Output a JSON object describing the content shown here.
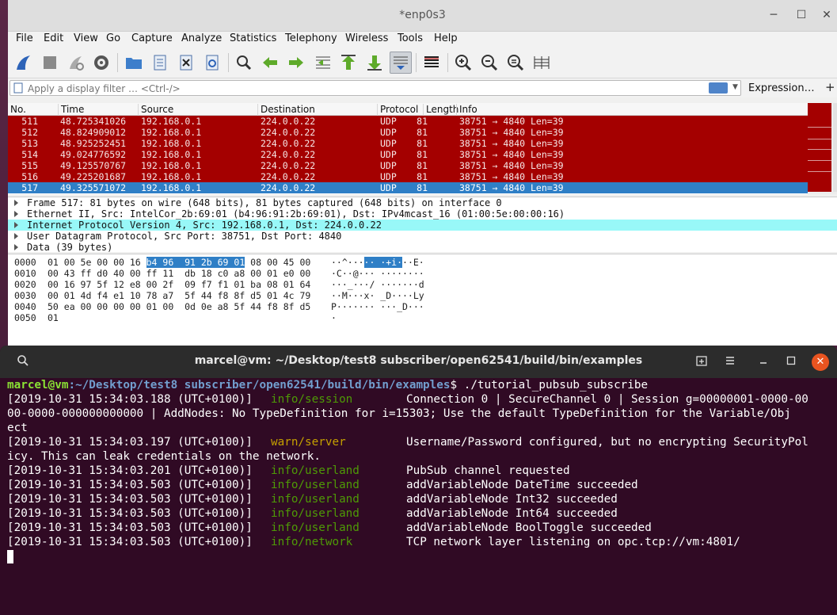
{
  "wireshark": {
    "title": "*enp0s3",
    "controls": {
      "minimize": "─",
      "maximize": "☐",
      "close": "✕"
    },
    "menu": [
      "File",
      "Edit",
      "View",
      "Go",
      "Capture",
      "Analyze",
      "Statistics",
      "Telephony",
      "Wireless",
      "Tools",
      "Help"
    ],
    "toolbar": [
      "shark-fin-icon",
      "stop-icon",
      "restart-icon",
      "options-gear-icon",
      "open-folder-icon",
      "file-icon",
      "close-file-icon",
      "reload-icon",
      "find-icon",
      "back-arrow-icon",
      "forward-arrow-icon",
      "goto-packet-icon",
      "first-packet-icon",
      "last-packet-icon",
      "autoscroll-icon",
      "colorize-icon",
      "zoom-in-icon",
      "zoom-out-icon",
      "zoom-normal-icon",
      "resize-columns-icon"
    ],
    "filter": {
      "placeholder": "Apply a display filter … <Ctrl-/>",
      "expression_label": "Expression…",
      "plus_label": "+"
    },
    "columns": [
      "No.",
      "Time",
      "Source",
      "Destination",
      "Protocol",
      "Length",
      "Info"
    ],
    "packets": [
      {
        "no": "511",
        "time": "48.725341026",
        "src": "192.168.0.1",
        "dst": "224.0.0.22",
        "proto": "UDP",
        "len": "81",
        "info": "38751 → 4840 Len=39"
      },
      {
        "no": "512",
        "time": "48.824909012",
        "src": "192.168.0.1",
        "dst": "224.0.0.22",
        "proto": "UDP",
        "len": "81",
        "info": "38751 → 4840 Len=39"
      },
      {
        "no": "513",
        "time": "48.925252451",
        "src": "192.168.0.1",
        "dst": "224.0.0.22",
        "proto": "UDP",
        "len": "81",
        "info": "38751 → 4840 Len=39"
      },
      {
        "no": "514",
        "time": "49.024776592",
        "src": "192.168.0.1",
        "dst": "224.0.0.22",
        "proto": "UDP",
        "len": "81",
        "info": "38751 → 4840 Len=39"
      },
      {
        "no": "515",
        "time": "49.125570767",
        "src": "192.168.0.1",
        "dst": "224.0.0.22",
        "proto": "UDP",
        "len": "81",
        "info": "38751 → 4840 Len=39"
      },
      {
        "no": "516",
        "time": "49.225201687",
        "src": "192.168.0.1",
        "dst": "224.0.0.22",
        "proto": "UDP",
        "len": "81",
        "info": "38751 → 4840 Len=39"
      },
      {
        "no": "517",
        "time": "49.325571072",
        "src": "192.168.0.1",
        "dst": "224.0.0.22",
        "proto": "UDP",
        "len": "81",
        "info": "38751 → 4840 Len=39"
      }
    ],
    "details": [
      "Frame 517: 81 bytes on wire (648 bits), 81 bytes captured (648 bits) on interface 0",
      "Ethernet II, Src: IntelCor_2b:69:01 (b4:96:91:2b:69:01), Dst: IPv4mcast_16 (01:00:5e:00:00:16)",
      "Internet Protocol Version 4, Src: 192.168.0.1, Dst: 224.0.0.22",
      "User Datagram Protocol, Src Port: 38751, Dst Port: 4840",
      "Data (39 bytes)"
    ],
    "bytes": [
      {
        "off": "0000",
        "pre": "01 00 5e 00 00 16 ",
        "hl": "b4 96  91 2b 69 01",
        "post": " 08 00 45 00",
        "a_pre": "··^···",
        "a_hl": "·· ·+i·",
        "a_post": "··E·"
      },
      {
        "off": "0010",
        "pre": "00 43 ff d0 40 00 ff 11  db 18 c0 a8 00 01 e0 00",
        "hl": "",
        "post": "",
        "a_pre": "·C··@··· ········",
        "a_hl": "",
        "a_post": ""
      },
      {
        "off": "0020",
        "pre": "00 16 97 5f 12 e8 00 2f  09 f7 f1 01 ba 08 01 64",
        "hl": "",
        "post": "",
        "a_pre": "···_···/ ·······d",
        "a_hl": "",
        "a_post": ""
      },
      {
        "off": "0030",
        "pre": "00 01 4d f4 e1 10 78 a7  5f 44 f8 8f d5 01 4c 79",
        "hl": "",
        "post": "",
        "a_pre": "··M···x· _D····Ly",
        "a_hl": "",
        "a_post": ""
      },
      {
        "off": "0040",
        "pre": "50 ea 00 00 00 00 01 00  0d 0e a8 5f 44 f8 8f d5",
        "hl": "",
        "post": "",
        "a_pre": "P······· ···_D···",
        "a_hl": "",
        "a_post": ""
      },
      {
        "off": "0050",
        "pre": "01",
        "hl": "",
        "post": "",
        "a_pre": "·",
        "a_hl": "",
        "a_post": ""
      }
    ]
  },
  "terminal": {
    "title": "marcel@vm: ~/Desktop/test8 subscriber/open62541/build/bin/examples",
    "prompt_user": "marcel@vm",
    "prompt_path": ":~/Desktop/test8 subscriber/open62541/build/bin/examples",
    "prompt_command": "$ ./tutorial_pubsub_subscribe",
    "lines": [
      {
        "ts": "[2019-10-31 15:34:03.188 (UTC+0100)]",
        "lvl": "info/session",
        "kind": "info",
        "msg": "Connection 0 | SecureChannel 0 | Session g=00000001-0000-00"
      },
      {
        "ts": "00-0000-000000000000 | AddNodes: No TypeDefinition for i=15303; Use the default TypeDefinition for the Variable/Obj",
        "lvl": "",
        "kind": "cont",
        "msg": ""
      },
      {
        "ts": "ect",
        "lvl": "",
        "kind": "cont",
        "msg": ""
      },
      {
        "ts": "[2019-10-31 15:34:03.197 (UTC+0100)]",
        "lvl": "warn/server",
        "kind": "warn",
        "msg": "Username/Password configured, but no encrypting SecurityPol"
      },
      {
        "ts": "icy. This can leak credentials on the network.",
        "lvl": "",
        "kind": "cont",
        "msg": ""
      },
      {
        "ts": "[2019-10-31 15:34:03.201 (UTC+0100)]",
        "lvl": "info/userland",
        "kind": "info",
        "msg": "PubSub channel requested"
      },
      {
        "ts": "[2019-10-31 15:34:03.503 (UTC+0100)]",
        "lvl": "info/userland",
        "kind": "info",
        "msg": "addVariableNode DateTime succeeded"
      },
      {
        "ts": "[2019-10-31 15:34:03.503 (UTC+0100)]",
        "lvl": "info/userland",
        "kind": "info",
        "msg": "addVariableNode Int32 succeeded"
      },
      {
        "ts": "[2019-10-31 15:34:03.503 (UTC+0100)]",
        "lvl": "info/userland",
        "kind": "info",
        "msg": "addVariableNode Int64 succeeded"
      },
      {
        "ts": "[2019-10-31 15:34:03.503 (UTC+0100)]",
        "lvl": "info/userland",
        "kind": "info",
        "msg": "addVariableNode BoolToggle succeeded"
      },
      {
        "ts": "[2019-10-31 15:34:03.503 (UTC+0100)]",
        "lvl": "info/network",
        "kind": "info",
        "msg": "TCP network layer listening on opc.tcp://vm:4801/"
      }
    ]
  },
  "colors": {
    "packet_bg": "#a40000",
    "selected_bg": "#2f7fc6",
    "detail_highlight": "#98f8f8",
    "terminal_bg": "#300a24",
    "prompt_user": "#8ae234",
    "prompt_path": "#729fcf",
    "close_button": "#e95420"
  }
}
